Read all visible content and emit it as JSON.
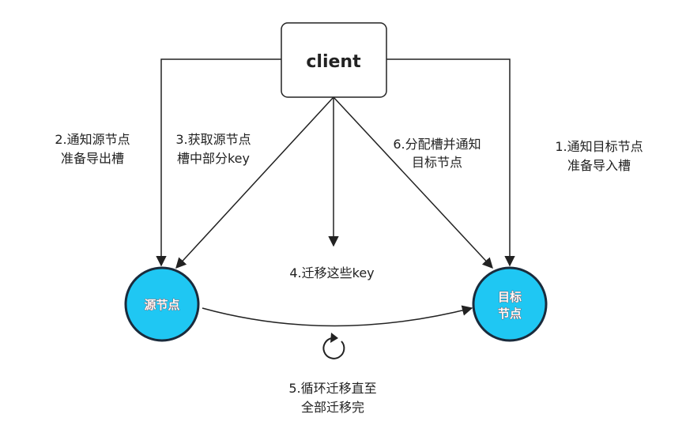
{
  "client": {
    "label": "client"
  },
  "source_node": {
    "label": "源节点",
    "fill": "#1fc7f3",
    "stroke": "#1a2b3c"
  },
  "target_node": {
    "line1": "目标",
    "line2": "节点",
    "fill": "#1fc7f3",
    "stroke": "#1a2b3c"
  },
  "steps": {
    "step1": {
      "line1": "1.通知目标节点",
      "line2": "准备导入槽"
    },
    "step2": {
      "line1": "2.通知源节点",
      "line2": "准备导出槽"
    },
    "step3": {
      "line1": "3.获取源节点",
      "line2": "槽中部分key"
    },
    "step4": {
      "line1": "4.迁移这些key"
    },
    "step5": {
      "line1": "5.循环迁移直至",
      "line2": "全部迁移完"
    },
    "step6": {
      "line1": "6.分配槽并通知",
      "line2": "目标节点"
    }
  },
  "icons": {
    "loop": "refresh-icon"
  }
}
